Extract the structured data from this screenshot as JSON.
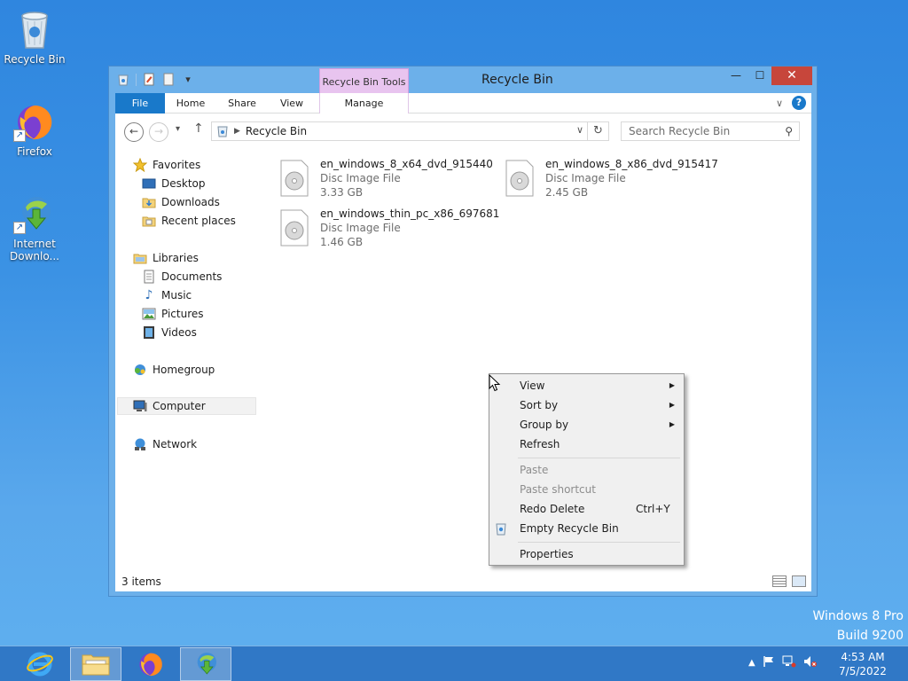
{
  "desktop": {
    "icons": [
      {
        "label": "Recycle Bin"
      },
      {
        "label": "Firefox"
      },
      {
        "label": "Internet Downlo..."
      }
    ],
    "watermark": {
      "line1": "Windows 8 Pro",
      "line2": "Build 9200"
    }
  },
  "window": {
    "title": "Recycle Bin",
    "context_tab_header": "Recycle Bin Tools",
    "ribbon_tabs": {
      "file": "File",
      "home": "Home",
      "share": "Share",
      "view": "View",
      "manage": "Manage"
    },
    "address": {
      "path": "Recycle Bin"
    },
    "search": {
      "placeholder": "Search Recycle Bin"
    },
    "nav": {
      "favorites": "Favorites",
      "desktop": "Desktop",
      "downloads": "Downloads",
      "recent": "Recent places",
      "libraries": "Libraries",
      "documents": "Documents",
      "music": "Music",
      "pictures": "Pictures",
      "videos": "Videos",
      "homegroup": "Homegroup",
      "computer": "Computer",
      "network": "Network"
    },
    "files": [
      {
        "name": "en_windows_8_x64_dvd_915440",
        "type": "Disc Image File",
        "size": "3.33 GB"
      },
      {
        "name": "en_windows_8_x86_dvd_915417",
        "type": "Disc Image File",
        "size": "2.45 GB"
      },
      {
        "name": "en_windows_thin_pc_x86_697681",
        "type": "Disc Image File",
        "size": "1.46 GB"
      }
    ],
    "status": {
      "count": "3 items"
    }
  },
  "context_menu": {
    "view": "View",
    "sort_by": "Sort by",
    "group_by": "Group by",
    "refresh": "Refresh",
    "paste": "Paste",
    "paste_shortcut": "Paste shortcut",
    "redo_delete": "Redo Delete",
    "redo_shortcut": "Ctrl+Y",
    "empty_bin": "Empty Recycle Bin",
    "properties": "Properties"
  },
  "taskbar": {
    "time": "4:53 AM",
    "date": "7/5/2022"
  },
  "colors": {
    "accent": "#1979ca",
    "close": "#c7463b",
    "context_tab": "#e8c4ef"
  }
}
